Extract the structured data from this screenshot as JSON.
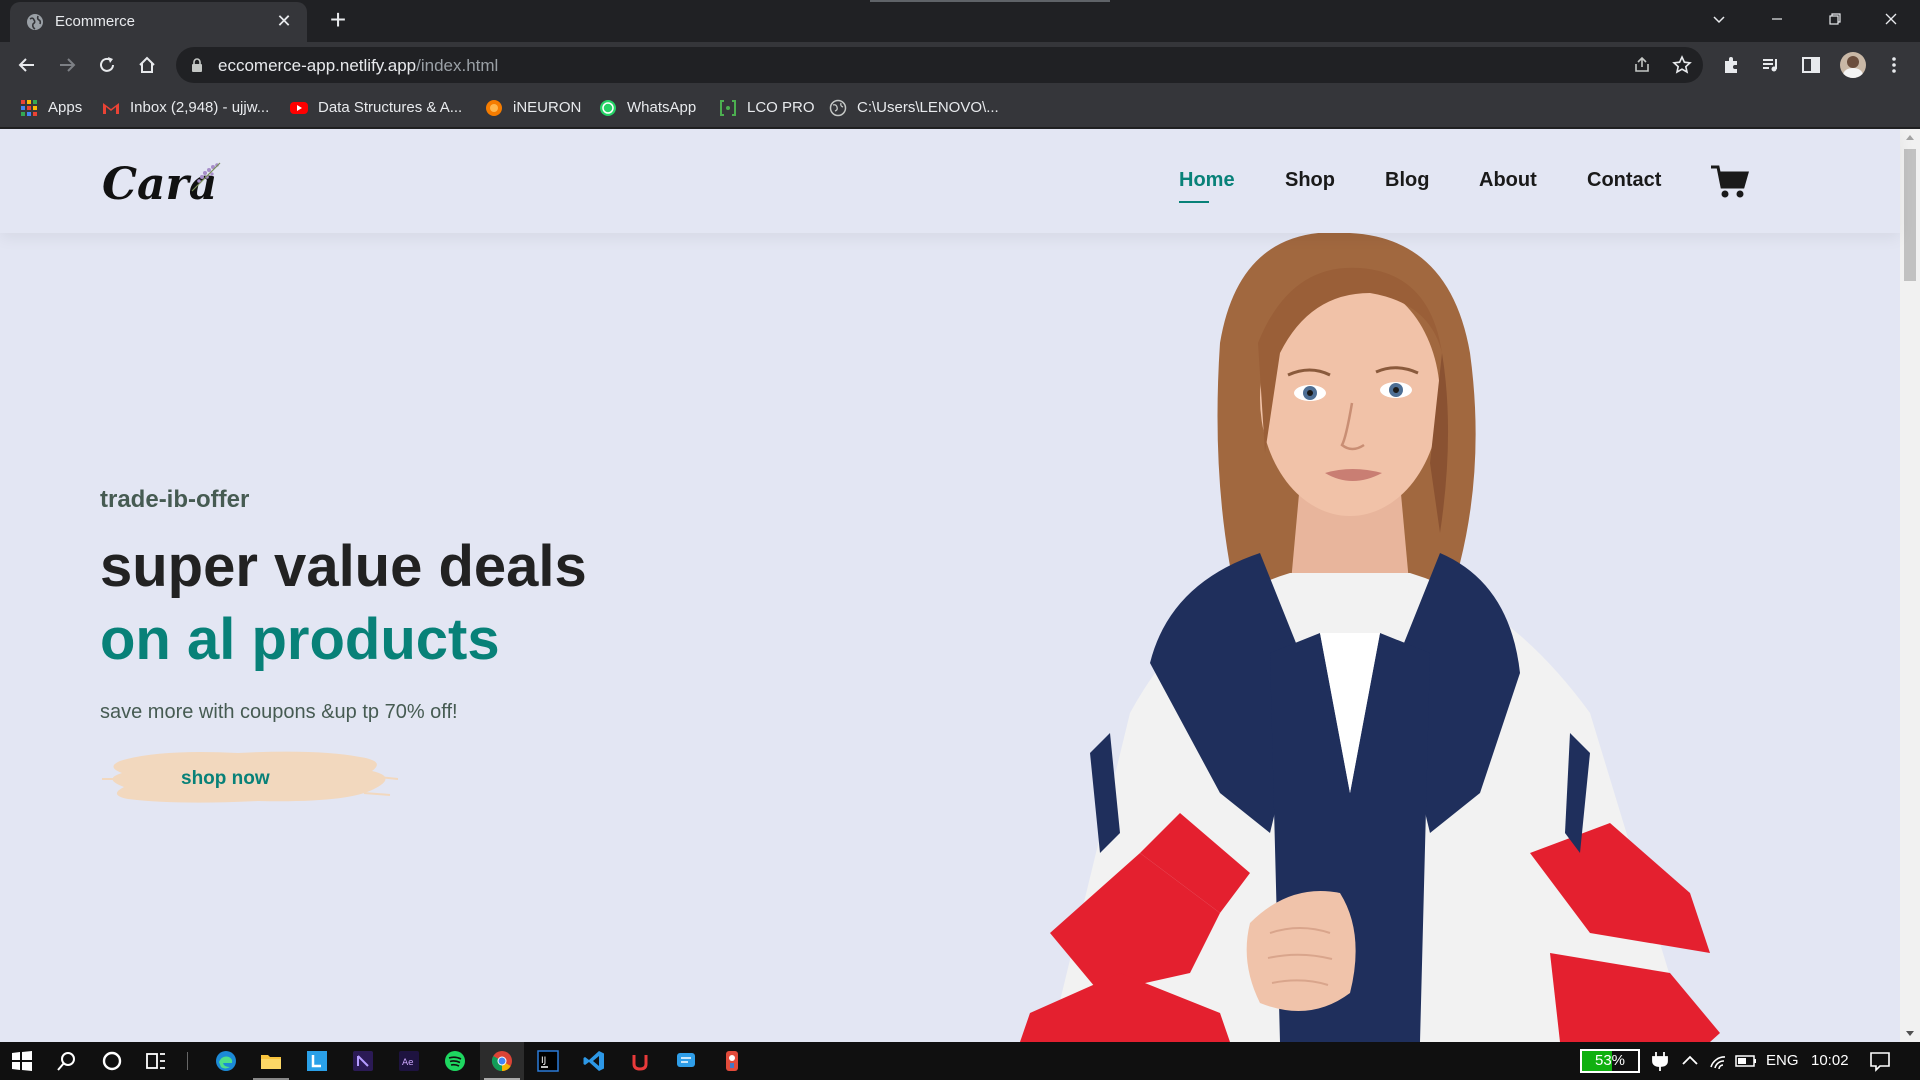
{
  "browser": {
    "tab_title": "Ecommerce",
    "tab_close": "✕",
    "new_tab": "+",
    "url_host": "eccomerce-app.netlify.app",
    "url_path": "/index.html",
    "bookmarks": [
      {
        "label": "Apps",
        "icon": "apps-grid-icon"
      },
      {
        "label": "Inbox (2,948) - ujjw...",
        "icon": "gmail-icon"
      },
      {
        "label": "Data Structures & A...",
        "icon": "youtube-icon"
      },
      {
        "label": "iNEURON",
        "icon": "ineuron-icon"
      },
      {
        "label": "WhatsApp",
        "icon": "whatsapp-icon"
      },
      {
        "label": "LCO PRO",
        "icon": "lco-icon"
      },
      {
        "label": "C:\\Users\\LENOVO\\...",
        "icon": "globe-icon"
      }
    ]
  },
  "site": {
    "logo": "Cara",
    "nav": [
      "Home",
      "Shop",
      "Blog",
      "About",
      "Contact"
    ],
    "active_nav": "Home",
    "hero": {
      "subtitle": "trade-ib-offer",
      "heading": "super value deals",
      "heading_accent": "on al products",
      "text": "save more with coupons &up tp 70% off!",
      "button": "shop now"
    },
    "colors": {
      "accent": "#088178",
      "background": "#e3e6f3",
      "button_brush": "#f2d8be"
    }
  },
  "taskbar": {
    "battery": "53%",
    "language": "ENG",
    "time": "10:02"
  }
}
